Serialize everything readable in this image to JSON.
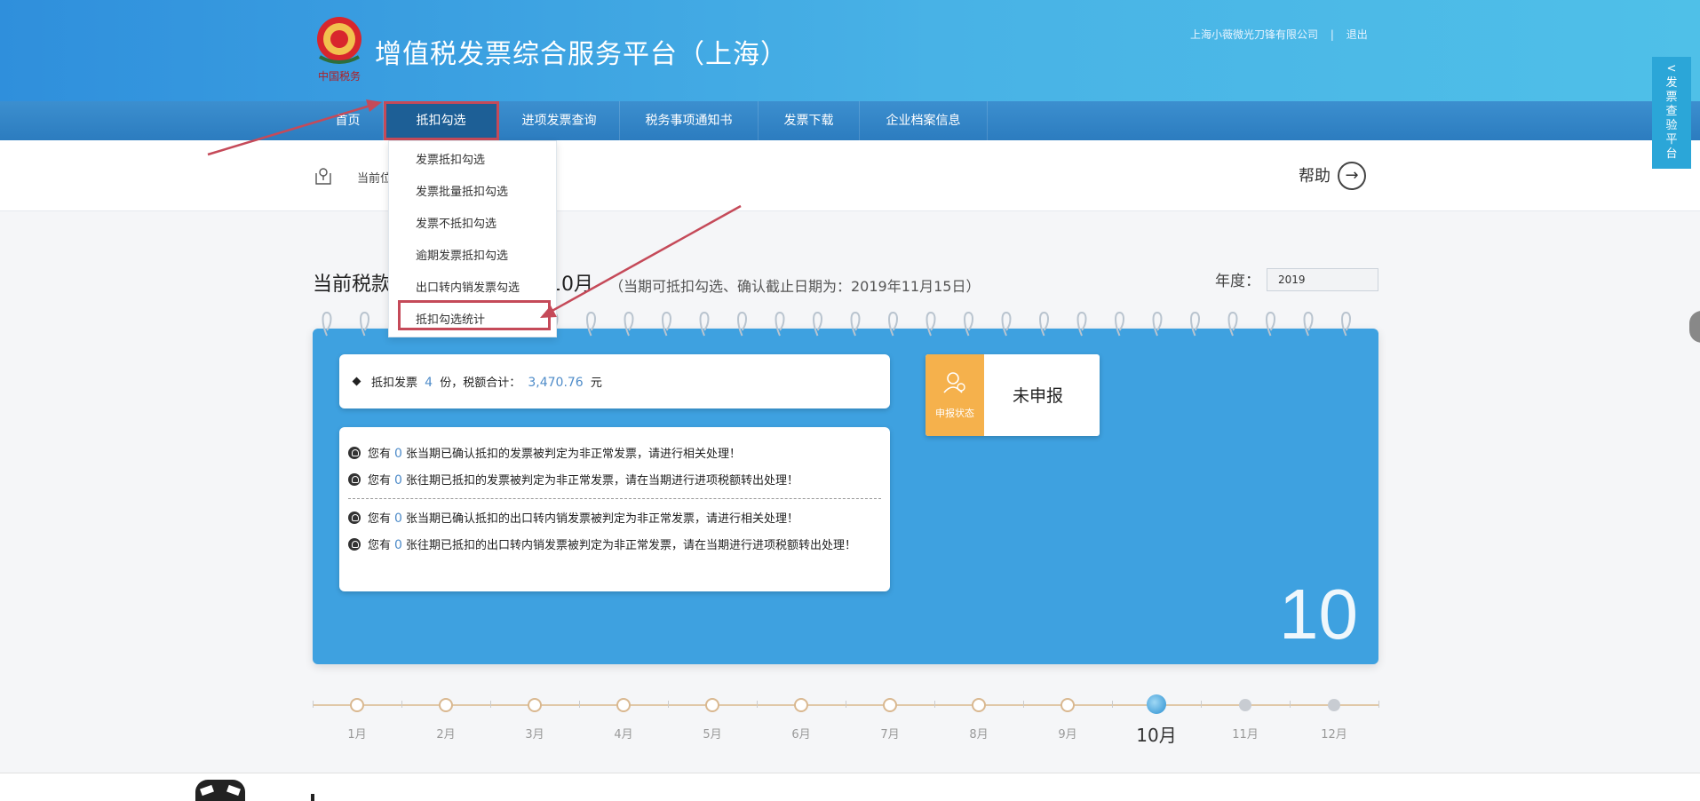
{
  "header": {
    "title": "增值税发票综合服务平台（上海）",
    "logo_text": "中国税务",
    "company": "上海小薇微光刀锋有限公司",
    "logout": "退出"
  },
  "nav": {
    "items": [
      "首页",
      "抵扣勾选",
      "进项发票查询",
      "税务事项通知书",
      "发票下载",
      "企业档案信息"
    ],
    "active": "抵扣勾选"
  },
  "dropdown": {
    "items": [
      "发票抵扣勾选",
      "发票批量抵扣勾选",
      "发票不抵扣勾选",
      "逾期发票抵扣勾选",
      "出口转内销发票勾选",
      "抵扣勾选统计"
    ],
    "highlighted": "抵扣勾选统计"
  },
  "breadcrumb": {
    "label": "当前位"
  },
  "help": {
    "label": "帮助",
    "icon": "arrow-right-circle-icon"
  },
  "period": {
    "title": "当前税款",
    "month": "10月",
    "note": "（当期可抵扣勾选、确认截止日期为：2019年11月15日）",
    "year_label": "年度：",
    "year_value": "2019"
  },
  "summary": {
    "prefix": "抵扣发票",
    "count": "4",
    "mid": "份，税额合计：",
    "amount": "3,470.76",
    "unit": "元"
  },
  "warnings": [
    {
      "pre": "您有",
      "count": "0",
      "text": "张当期已确认抵扣的发票被判定为非正常发票，请进行相关处理！"
    },
    {
      "pre": "您有",
      "count": "0",
      "text": "张往期已抵扣的发票被判定为非正常发票，请在当期进行进项税额转出处理！"
    },
    {
      "pre": "您有",
      "count": "0",
      "text": "张当期已确认抵扣的出口转内销发票被判定为非正常发票，请进行相关处理！"
    },
    {
      "pre": "您有",
      "count": "0",
      "text": "张往期已抵扣的出口转内销发票被判定为非正常发票，请在当期进行进项税额转出处理！"
    }
  ],
  "status": {
    "icon_label": "申报状态",
    "value": "未申报"
  },
  "big_month": "10",
  "timeline": {
    "months": [
      "1月",
      "2月",
      "3月",
      "4月",
      "5月",
      "6月",
      "7月",
      "8月",
      "9月",
      "10月",
      "11月",
      "12月"
    ],
    "current": "10月"
  },
  "side_tab": {
    "label": "发票查验平台",
    "arrow": "<"
  },
  "colors": {
    "brand_blue": "#3ea1e0",
    "highlight_red": "#c54a59",
    "status_orange": "#f5b14c",
    "nav_dark": "#2c7cbf"
  }
}
